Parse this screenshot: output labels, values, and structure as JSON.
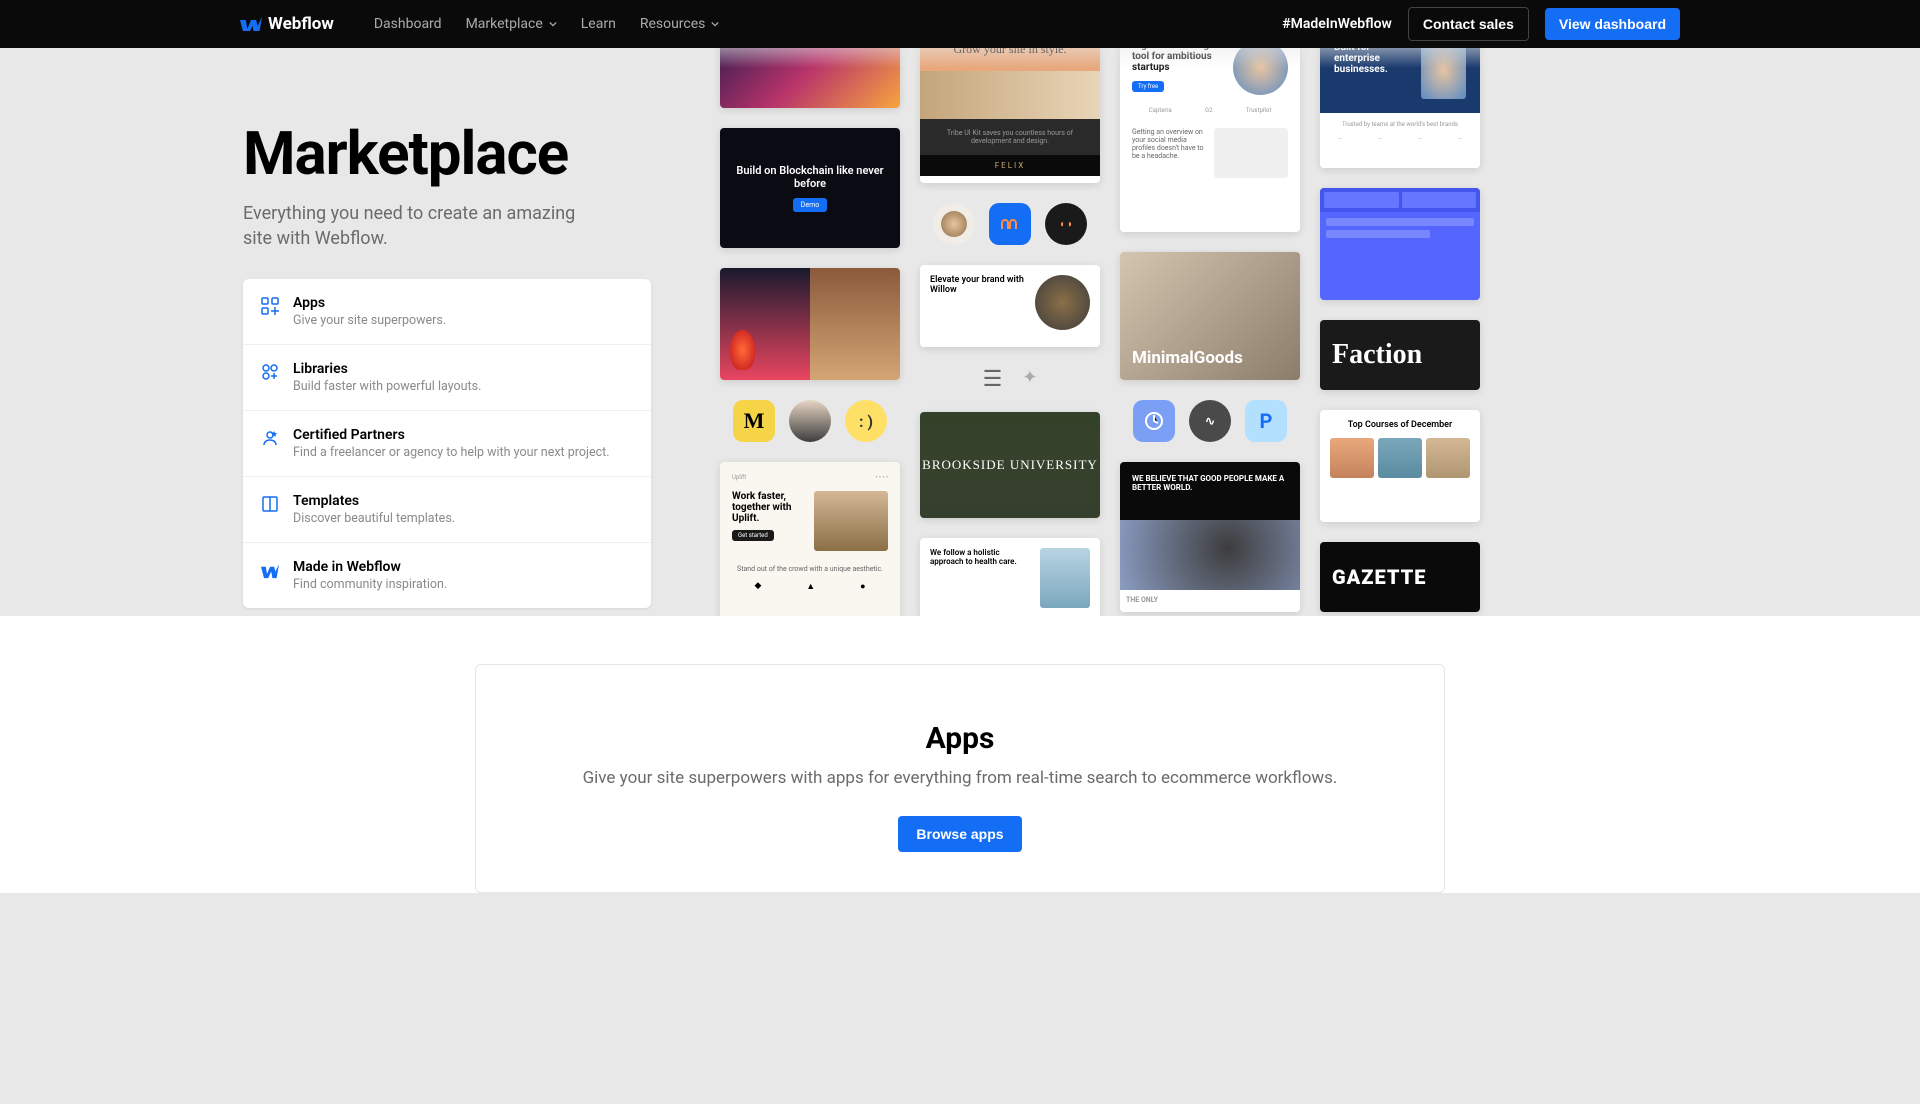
{
  "brand": "Webflow",
  "nav": {
    "dashboard": "Dashboard",
    "marketplace": "Marketplace",
    "learn": "Learn",
    "resources": "Resources"
  },
  "header": {
    "hashtag": "#MadeInWebflow",
    "contact": "Contact sales",
    "dashboard_btn": "View dashboard"
  },
  "hero": {
    "title": "Marketplace",
    "subtitle": "Everything you need to create an amazing site with Webflow."
  },
  "cards": [
    {
      "title": "Apps",
      "desc": "Give your site superpowers."
    },
    {
      "title": "Libraries",
      "desc": "Build faster with powerful layouts."
    },
    {
      "title": "Certified Partners",
      "desc": "Find a freelancer or agency to help with your next project."
    },
    {
      "title": "Templates",
      "desc": "Discover beautiful templates."
    },
    {
      "title": "Made in Webflow",
      "desc": "Find community inspiration."
    }
  ],
  "gallery": {
    "col1": {
      "blockchain": "Build on Blockchain like never before",
      "uplift_title": "Work faster, together with Uplift.",
      "uplift_sub": "Stand out of the crowd with a unique aesthetic."
    },
    "col2": {
      "grow": "Grow your site in style.",
      "tribe": "Tribe UI Kit saves you countless hours of development and design.",
      "felix": "FELIX",
      "willow": "Elevate your brand with Willow",
      "brookside": "BROOKSIDE UNIVERSITY",
      "health": "We follow a holistic approach to health care."
    },
    "col3": {
      "digital": "Digital marketing tool for ambitious startups",
      "overview": "Getting an overview on your social media profiles doesn't have to be a headache.",
      "minimal": "MinimalGoods",
      "believe": "WE BELIEVE THAT GOOD PEOPLE MAKE A BETTER WORLD.",
      "journey": "THE ONLY"
    },
    "col4": {
      "enterprise": "Built for enterprise businesses.",
      "faction": "Faction",
      "courses": "Top Courses of December",
      "gazette": "GAZETTE"
    }
  },
  "apps": {
    "title": "Apps",
    "subtitle": "Give your site superpowers with apps for everything from real-time search to ecommerce workflows.",
    "btn": "Browse apps"
  }
}
